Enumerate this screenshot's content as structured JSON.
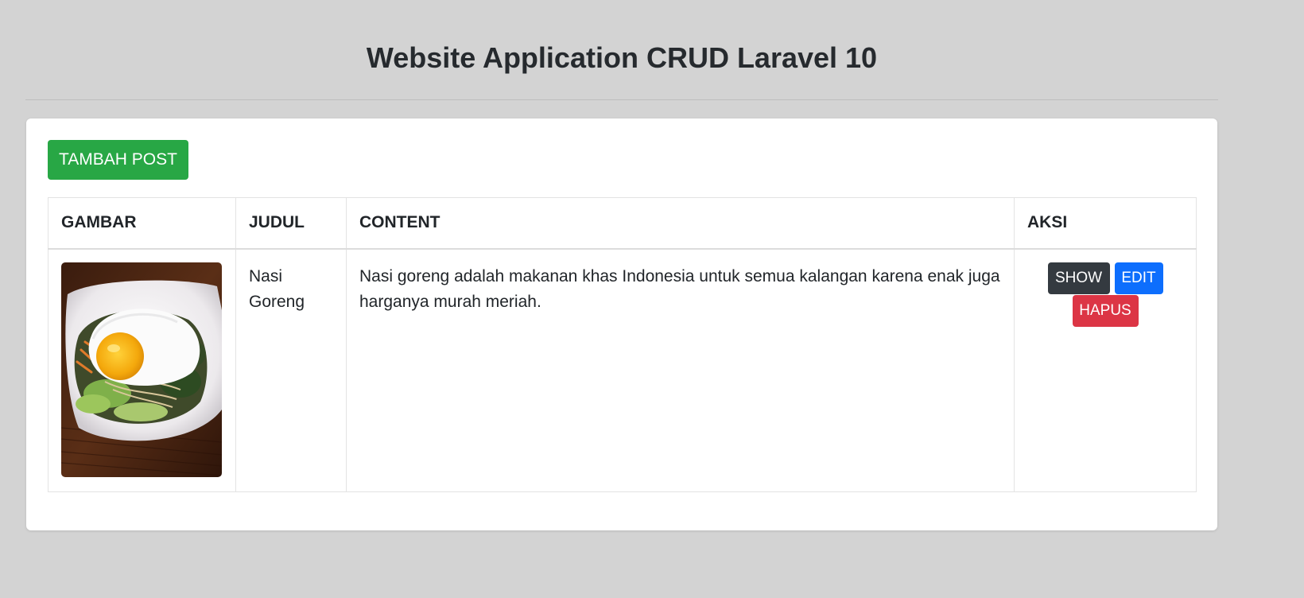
{
  "page": {
    "title": "Website Application CRUD Laravel 10"
  },
  "toolbar": {
    "add_label": "TAMBAH POST"
  },
  "table": {
    "headers": [
      "GAMBAR",
      "JUDUL",
      "CONTENT",
      "AKSI"
    ],
    "rows": [
      {
        "image": "food-photo",
        "judul": "Nasi Goreng",
        "content": "Nasi goreng adalah makanan khas Indonesia untuk semua kalangan karena enak juga harganya murah meriah.",
        "actions": {
          "show_label": "SHOW",
          "edit_label": "EDIT",
          "delete_label": "HAPUS"
        }
      }
    ]
  },
  "colors": {
    "background": "#d3d3d3",
    "add": "#28a745",
    "show": "#343a40",
    "edit": "#0d6efd",
    "delete": "#dc3545"
  }
}
